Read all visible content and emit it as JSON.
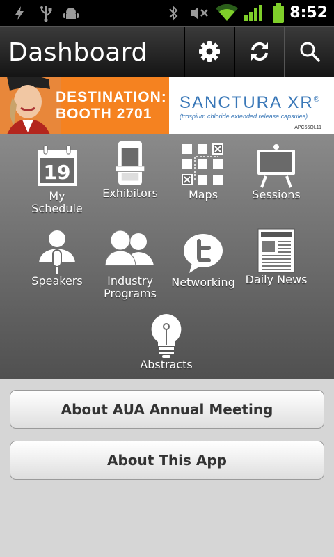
{
  "status_bar": {
    "time": "8:52"
  },
  "header": {
    "title": "Dashboard"
  },
  "banner": {
    "line1": "DESTINATION:",
    "line2": "BOOTH 2701",
    "brand": "SANCTURA XR",
    "brand_mark": "®",
    "subtitle": "(trospium chloride extended release capsules)",
    "code": "APC65QL11"
  },
  "grid": {
    "items": [
      {
        "label": "My\nSchedule",
        "icon": "calendar-icon",
        "day": "19"
      },
      {
        "label": "Exhibitors",
        "icon": "booth-icon"
      },
      {
        "label": "Maps",
        "icon": "map-icon"
      },
      {
        "label": "Sessions",
        "icon": "easel-icon"
      },
      {
        "label": "Speakers",
        "icon": "speaker-icon"
      },
      {
        "label": "Industry\nPrograms",
        "icon": "people-icon"
      },
      {
        "label": "Networking",
        "icon": "twitter-bubble-icon"
      },
      {
        "label": "Daily News",
        "icon": "newspaper-icon"
      },
      {
        "label": "Abstracts",
        "icon": "lightbulb-icon"
      }
    ]
  },
  "buttons": {
    "about_meeting": "About AUA Annual Meeting",
    "about_app": "About This App"
  }
}
